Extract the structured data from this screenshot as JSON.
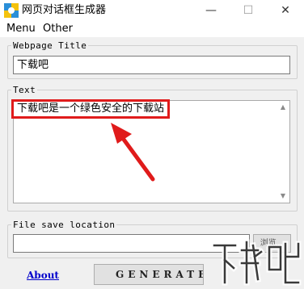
{
  "window": {
    "title": "网页对话框生成器",
    "controls": {
      "minimize": "—",
      "maximize": "☐",
      "close": "✕"
    }
  },
  "menu": {
    "items": [
      "Menu",
      "Other"
    ]
  },
  "webpage_title": {
    "label": "Webpage Title",
    "value": "下载吧"
  },
  "text_section": {
    "label": "Text",
    "value": "下载吧是一个绿色安全的下载站"
  },
  "file_save": {
    "label": "File save location",
    "value": "",
    "browse_label": "浏览..."
  },
  "footer": {
    "about_label": "About",
    "generate_label": "GENERATE"
  },
  "annotation": {
    "highlight_color": "#e01b1b"
  },
  "watermark": {
    "text": "下载吧"
  }
}
